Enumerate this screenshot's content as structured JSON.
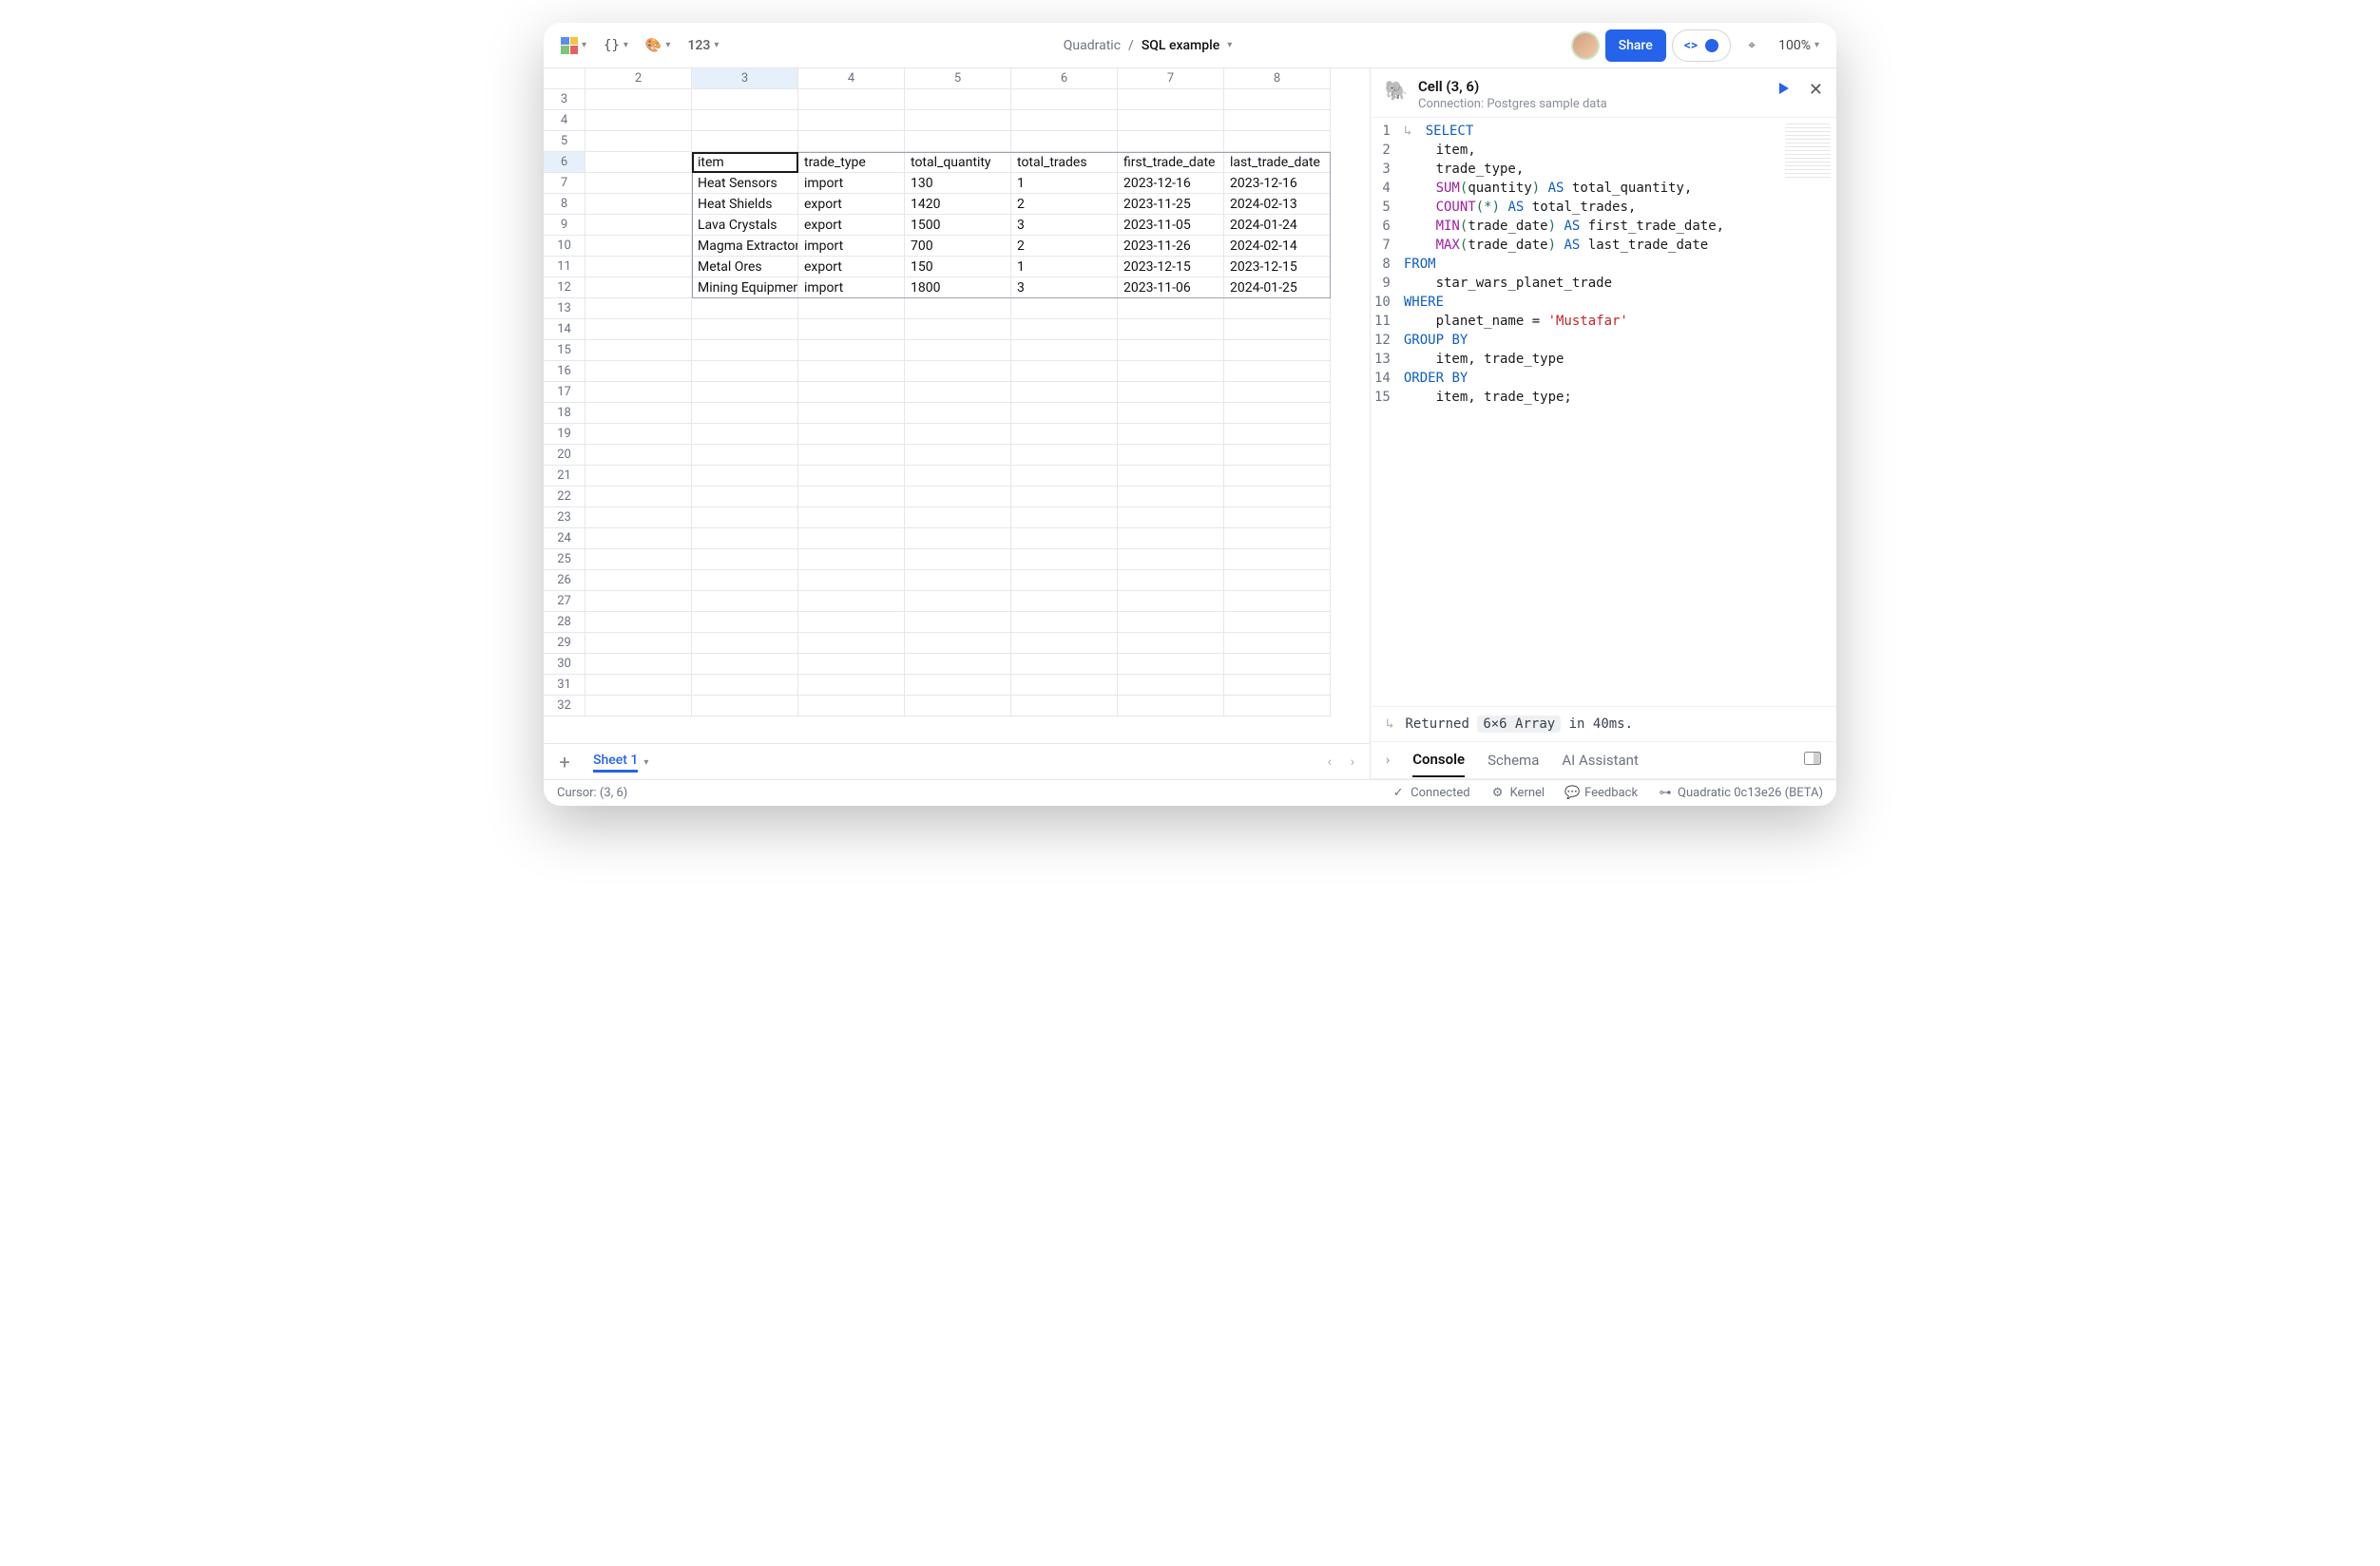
{
  "app": {
    "name": "Quadratic",
    "document_name": "SQL example",
    "number_format_label": "123",
    "zoom": "100%"
  },
  "topbar": {
    "share_label": "Share"
  },
  "sheet": {
    "active_tab": "Sheet 1",
    "col_headers": [
      "2",
      "3",
      "4",
      "5",
      "6",
      "7",
      "8"
    ],
    "selected_col": "3",
    "row_start": 3,
    "row_end": 32,
    "selected_row": 6,
    "data_start_row": 6,
    "data": {
      "headers": [
        "item",
        "trade_type",
        "total_quantity",
        "total_trades",
        "first_trade_date",
        "last_trade_date"
      ],
      "rows": [
        [
          "Heat Sensors",
          "import",
          "130",
          "1",
          "2023-12-16",
          "2023-12-16"
        ],
        [
          "Heat Shields",
          "export",
          "1420",
          "2",
          "2023-11-25",
          "2024-02-13"
        ],
        [
          "Lava Crystals",
          "export",
          "1500",
          "3",
          "2023-11-05",
          "2024-01-24"
        ],
        [
          "Magma Extractors",
          "import",
          "700",
          "2",
          "2023-11-26",
          "2024-02-14"
        ],
        [
          "Metal Ores",
          "export",
          "150",
          "1",
          "2023-12-15",
          "2023-12-15"
        ],
        [
          "Mining Equipment",
          "import",
          "1800",
          "3",
          "2023-11-06",
          "2024-01-25"
        ]
      ]
    }
  },
  "code_panel": {
    "cell_ref": "Cell (3, 6)",
    "connection_label": "Connection: Postgres sample data",
    "lines": [
      [
        {
          "t": "↳ ",
          "c": "return-arrow"
        },
        {
          "t": "SELECT",
          "c": "kw"
        }
      ],
      [
        {
          "t": "    item,"
        }
      ],
      [
        {
          "t": "    trade_type,"
        }
      ],
      [
        {
          "t": "    "
        },
        {
          "t": "SUM",
          "c": "fn"
        },
        {
          "t": "(",
          "c": "par"
        },
        {
          "t": "quantity"
        },
        {
          "t": ")",
          "c": "par"
        },
        {
          "t": " "
        },
        {
          "t": "AS",
          "c": "kw"
        },
        {
          "t": " total_quantity,"
        }
      ],
      [
        {
          "t": "    "
        },
        {
          "t": "COUNT",
          "c": "fn"
        },
        {
          "t": "(",
          "c": "par"
        },
        {
          "t": "*",
          "c": "star"
        },
        {
          "t": ")",
          "c": "par"
        },
        {
          "t": " "
        },
        {
          "t": "AS",
          "c": "kw"
        },
        {
          "t": " total_trades,"
        }
      ],
      [
        {
          "t": "    "
        },
        {
          "t": "MIN",
          "c": "fn"
        },
        {
          "t": "(",
          "c": "par"
        },
        {
          "t": "trade_date"
        },
        {
          "t": ")",
          "c": "par"
        },
        {
          "t": " "
        },
        {
          "t": "AS",
          "c": "kw"
        },
        {
          "t": " first_trade_date,"
        }
      ],
      [
        {
          "t": "    "
        },
        {
          "t": "MAX",
          "c": "fn"
        },
        {
          "t": "(",
          "c": "par"
        },
        {
          "t": "trade_date"
        },
        {
          "t": ")",
          "c": "par"
        },
        {
          "t": " "
        },
        {
          "t": "AS",
          "c": "kw"
        },
        {
          "t": " last_trade_date"
        }
      ],
      [
        {
          "t": "FROM",
          "c": "kw"
        }
      ],
      [
        {
          "t": "    star_wars_planet_trade"
        }
      ],
      [
        {
          "t": "WHERE",
          "c": "kw"
        }
      ],
      [
        {
          "t": "    planet_name = "
        },
        {
          "t": "'Mustafar'",
          "c": "str"
        }
      ],
      [
        {
          "t": "GROUP",
          "c": "kw"
        },
        {
          "t": " "
        },
        {
          "t": "BY",
          "c": "kw"
        }
      ],
      [
        {
          "t": "    item, trade_type"
        }
      ],
      [
        {
          "t": "ORDER",
          "c": "kw"
        },
        {
          "t": " "
        },
        {
          "t": "BY",
          "c": "kw"
        }
      ],
      [
        {
          "t": "    item, trade_type;"
        }
      ]
    ],
    "result_prefix": "Returned",
    "result_tag": "6×6 Array",
    "result_suffix": "in 40ms.",
    "tabs": {
      "console": "Console",
      "schema": "Schema",
      "ai": "AI Assistant"
    }
  },
  "status": {
    "cursor": "Cursor: (3, 6)",
    "connected": "Connected",
    "kernel": "Kernel",
    "feedback": "Feedback",
    "version": "Quadratic 0c13e26 (BETA)"
  }
}
